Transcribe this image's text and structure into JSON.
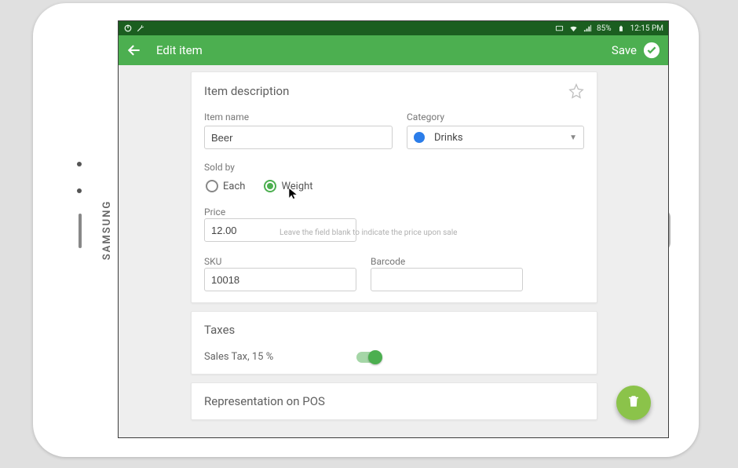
{
  "status": {
    "percent": "85%",
    "time": "12:15 PM"
  },
  "header": {
    "title": "Edit item",
    "save_label": "Save"
  },
  "sections": {
    "description": {
      "title": "Item description",
      "item_name_label": "Item name",
      "item_name_value": "Beer",
      "category_label": "Category",
      "category_value": "Drinks",
      "category_color": "#2b7de9",
      "sold_by_label": "Sold by",
      "sold_by_options": [
        "Each",
        "Weight"
      ],
      "sold_by_selected": 1,
      "price_label": "Price",
      "price_value": "12.00",
      "price_hint": "Leave the field blank to indicate the price upon sale",
      "sku_label": "SKU",
      "sku_value": "10018",
      "barcode_label": "Barcode",
      "barcode_value": ""
    },
    "taxes": {
      "title": "Taxes",
      "tax_line": "Sales Tax, 15 %",
      "tax_on": true
    },
    "representation": {
      "title": "Representation on POS"
    }
  }
}
